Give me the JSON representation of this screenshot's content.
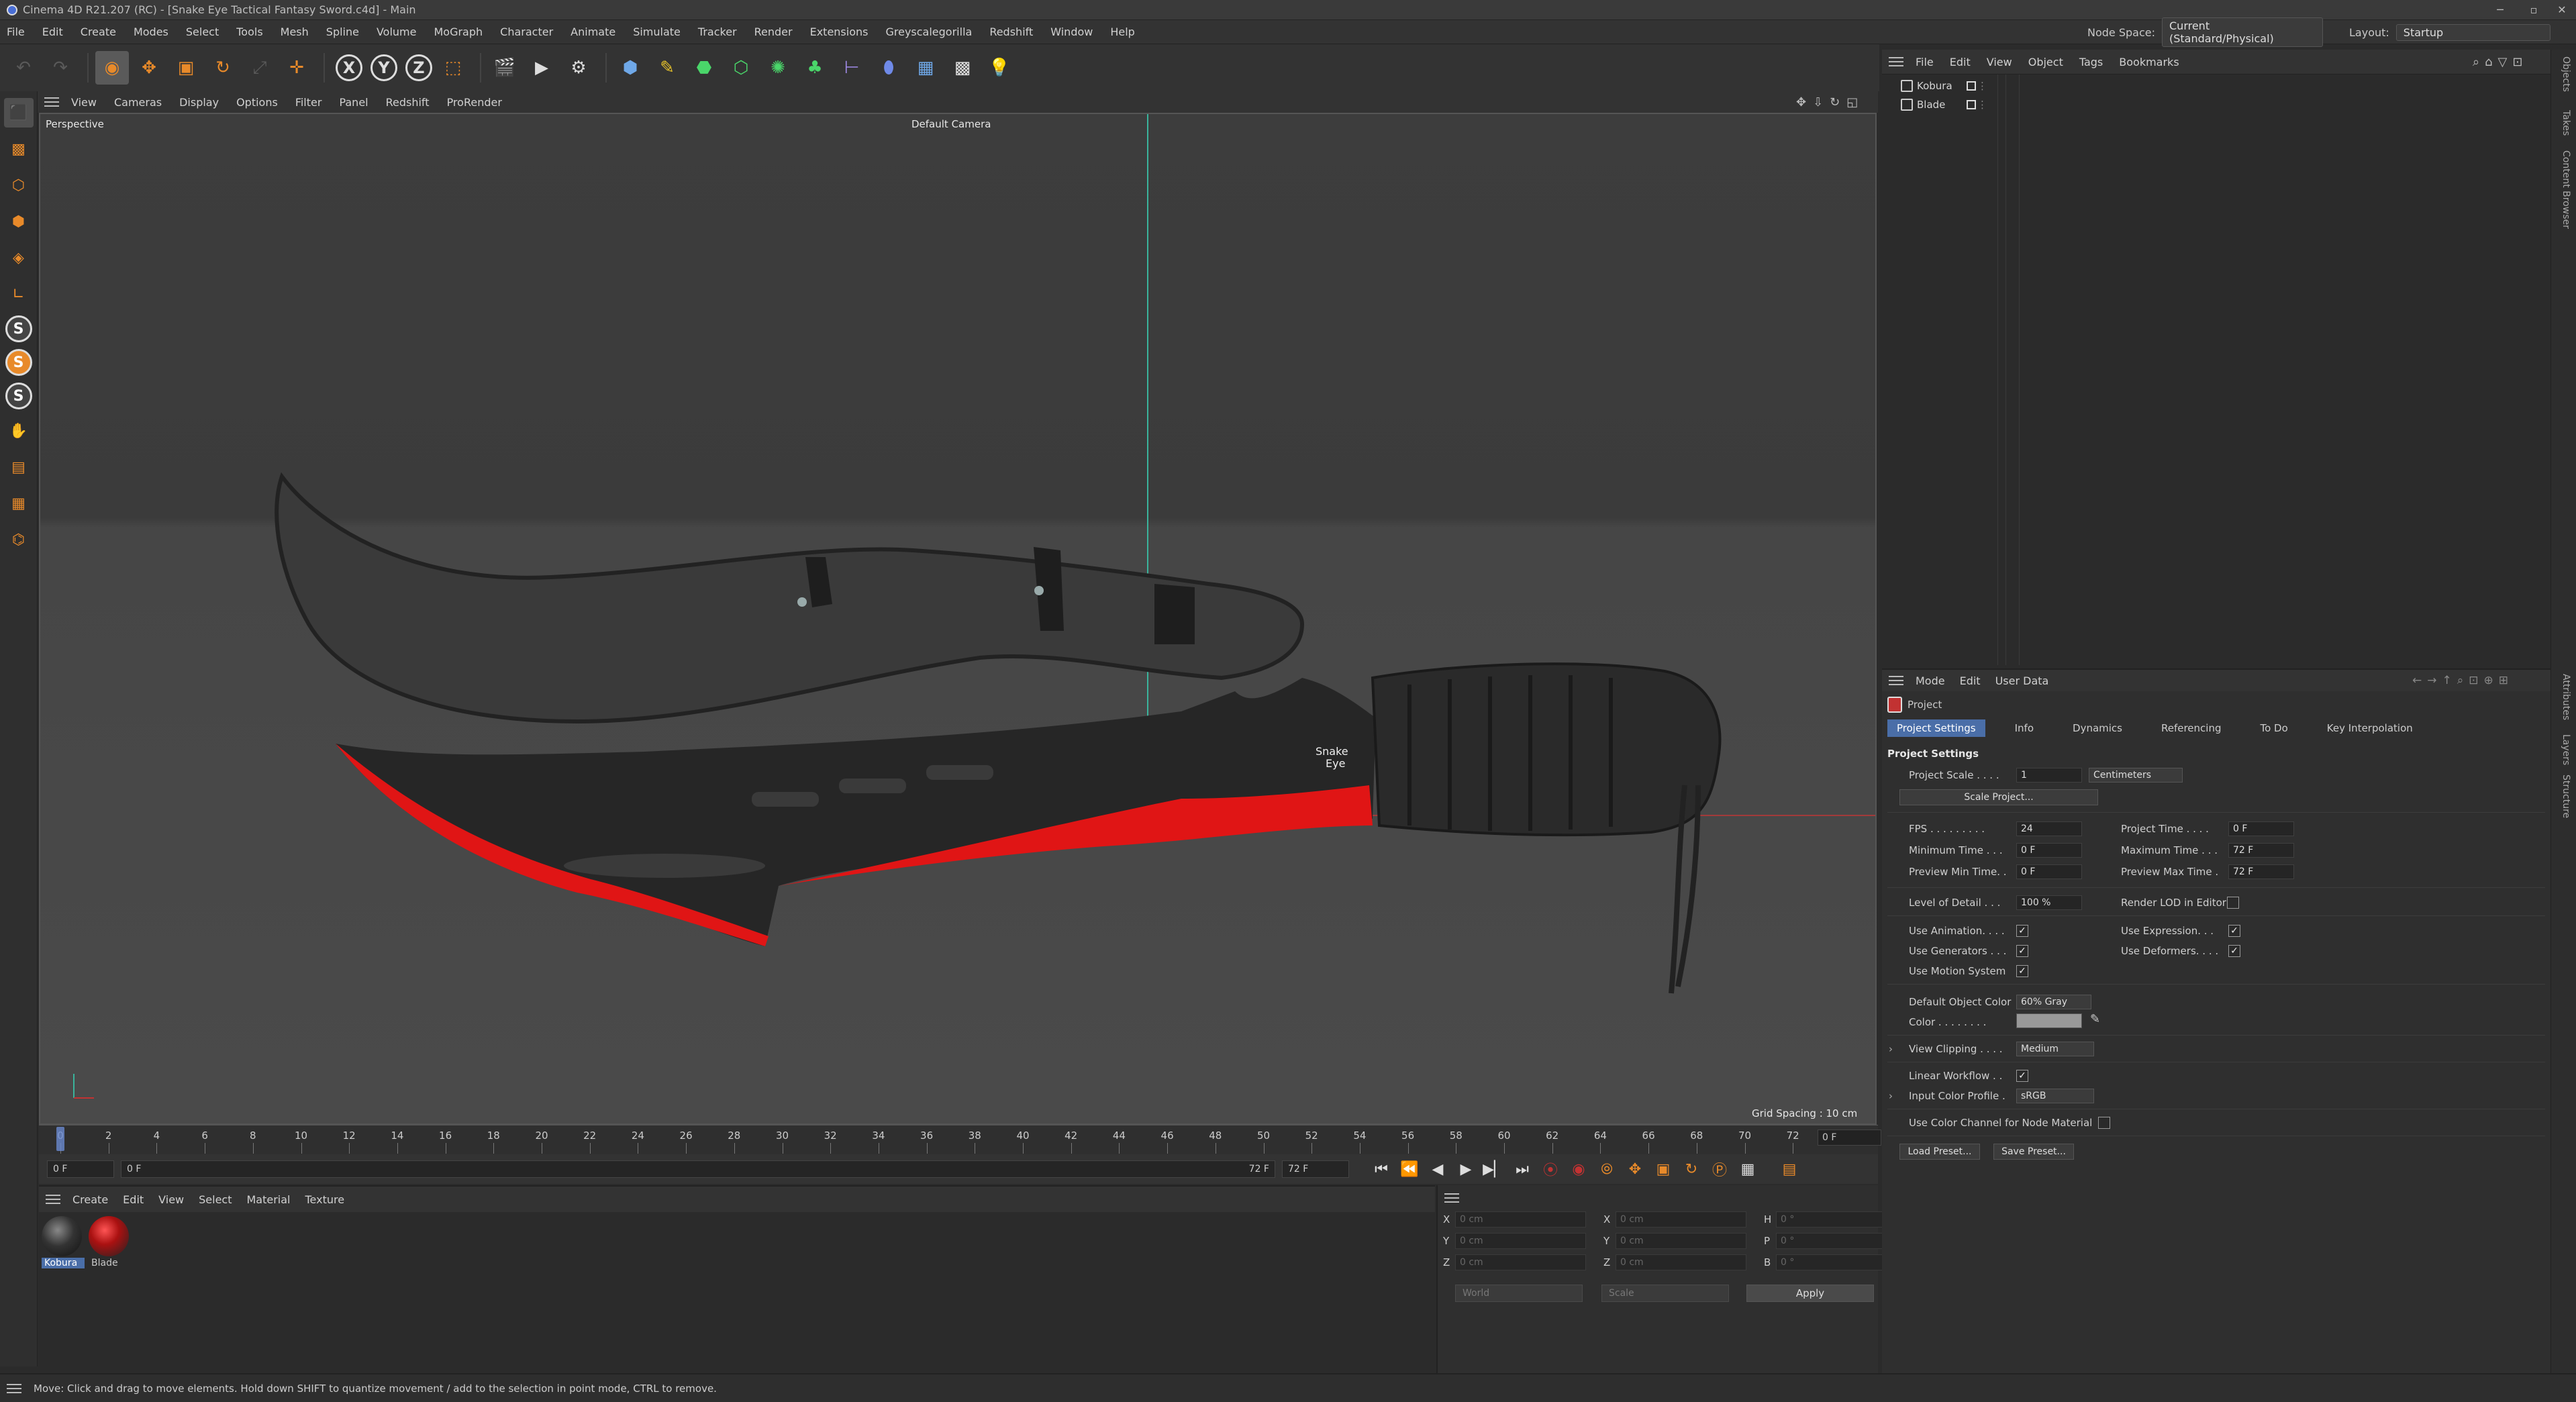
{
  "window": {
    "title": "Cinema 4D R21.207 (RC) - [Snake Eye Tactical Fantasy Sword.c4d] - Main"
  },
  "menubar": {
    "items": [
      "File",
      "Edit",
      "Create",
      "Modes",
      "Select",
      "Tools",
      "Mesh",
      "Spline",
      "Volume",
      "MoGraph",
      "Character",
      "Animate",
      "Simulate",
      "Tracker",
      "Render",
      "Extensions",
      "Greyscalegorilla",
      "Redshift",
      "Window",
      "Help"
    ],
    "node_space_label": "Node Space:",
    "node_space_value": "Current (Standard/Physical)",
    "layout_label": "Layout:",
    "layout_value": "Startup"
  },
  "toolbar": {
    "axis_x": "X",
    "axis_y": "Y",
    "axis_z": "Z"
  },
  "left_palette": {
    "s1": "S",
    "s2": "S",
    "s3": "S"
  },
  "viewport": {
    "menu": [
      "View",
      "Cameras",
      "Display",
      "Options",
      "Filter",
      "Panel",
      "Redshift",
      "ProRender"
    ],
    "projection": "Perspective",
    "camera": "Default Camera",
    "grid_spacing": "Grid Spacing : 10 cm",
    "logo_text_1": "Snake",
    "logo_text_2": "Eye"
  },
  "timeline": {
    "ticks": [
      "0",
      "2",
      "4",
      "6",
      "8",
      "10",
      "12",
      "14",
      "16",
      "18",
      "20",
      "22",
      "24",
      "26",
      "28",
      "30",
      "32",
      "34",
      "36",
      "38",
      "40",
      "42",
      "44",
      "46",
      "48",
      "50",
      "52",
      "54",
      "56",
      "58",
      "60",
      "62",
      "64",
      "66",
      "68",
      "70",
      "72"
    ],
    "current_frame": "0 F"
  },
  "transport": {
    "start": "0 F",
    "preview_start": "0 F",
    "preview_end": "72 F",
    "end": "72 F"
  },
  "material_manager": {
    "menu": [
      "Create",
      "Edit",
      "View",
      "Select",
      "Material",
      "Texture"
    ],
    "materials": [
      {
        "name": "Kobura",
        "selected": true
      },
      {
        "name": "Blade",
        "selected": false
      }
    ]
  },
  "coordinates": {
    "rows": [
      {
        "a1": "X",
        "v1": "0 cm",
        "a2": "X",
        "v2": "0 cm",
        "a3": "H",
        "v3": "0 °"
      },
      {
        "a1": "Y",
        "v1": "0 cm",
        "a2": "Y",
        "v2": "0 cm",
        "a3": "P",
        "v3": "0 °"
      },
      {
        "a1": "Z",
        "v1": "0 cm",
        "a2": "Z",
        "v2": "0 cm",
        "a3": "B",
        "v3": "0 °"
      }
    ],
    "world": "World",
    "scale": "Scale",
    "apply": "Apply"
  },
  "status": {
    "text": "Move: Click and drag to move elements. Hold down SHIFT to quantize movement / add to the selection in point mode, CTRL to remove."
  },
  "object_manager": {
    "menu": [
      "File",
      "Edit",
      "View",
      "Object",
      "Tags",
      "Bookmarks"
    ],
    "objects": [
      "Kobura",
      "Blade"
    ]
  },
  "right_tabs": {
    "top": [
      "Objects",
      "Takes",
      "Content Browser"
    ],
    "bottom": [
      "Attributes",
      "Layers",
      "Structure"
    ]
  },
  "attributes": {
    "menu": [
      "Mode",
      "Edit",
      "User Data"
    ],
    "object_name": "Project",
    "tabs": [
      "Project Settings",
      "Info",
      "Dynamics",
      "Referencing",
      "To Do",
      "Key Interpolation"
    ],
    "section": "Project Settings",
    "project_scale_label": "Project Scale . . . .",
    "project_scale_value": "1",
    "project_scale_unit": "Centimeters",
    "scale_project_btn": "Scale Project...",
    "fps_label": "FPS . . . . . . . . .",
    "fps_value": "24",
    "project_time_label": "Project Time . . . .",
    "project_time_value": "0 F",
    "min_time_label": "Minimum Time . . .",
    "min_time_value": "0 F",
    "max_time_label": "Maximum Time . . .",
    "max_time_value": "72 F",
    "prev_min_label": "Preview Min Time. .",
    "prev_min_value": "0 F",
    "prev_max_label": "Preview Max Time .",
    "prev_max_value": "72 F",
    "lod_label": "Level of Detail . . .",
    "lod_value": "100 %",
    "render_lod_label": "Render LOD in Editor",
    "use_animation_label": "Use Animation. . . .",
    "use_expression_label": "Use Expression. . .",
    "use_generators_label": "Use Generators . . .",
    "use_deformers_label": "Use Deformers. . . .",
    "use_motion_label": "Use Motion System",
    "default_color_label": "Default Object Color",
    "default_color_value": "60% Gray",
    "color_label": "Color . . . . . . . .",
    "view_clipping_label": "View Clipping . . . .",
    "view_clipping_value": "Medium",
    "linear_workflow_label": "Linear Workflow . .",
    "input_color_label": "Input Color Profile .",
    "input_color_value": "sRGB",
    "color_channel_label": "Use Color Channel for Node Material",
    "load_preset": "Load Preset...",
    "save_preset": "Save Preset...",
    "check_mark": "✓"
  },
  "colors": {
    "accent": "#4a6ea8",
    "blade_red": "#e01515",
    "axis_x": "#c23232",
    "axis_y": "#3ab39c"
  }
}
